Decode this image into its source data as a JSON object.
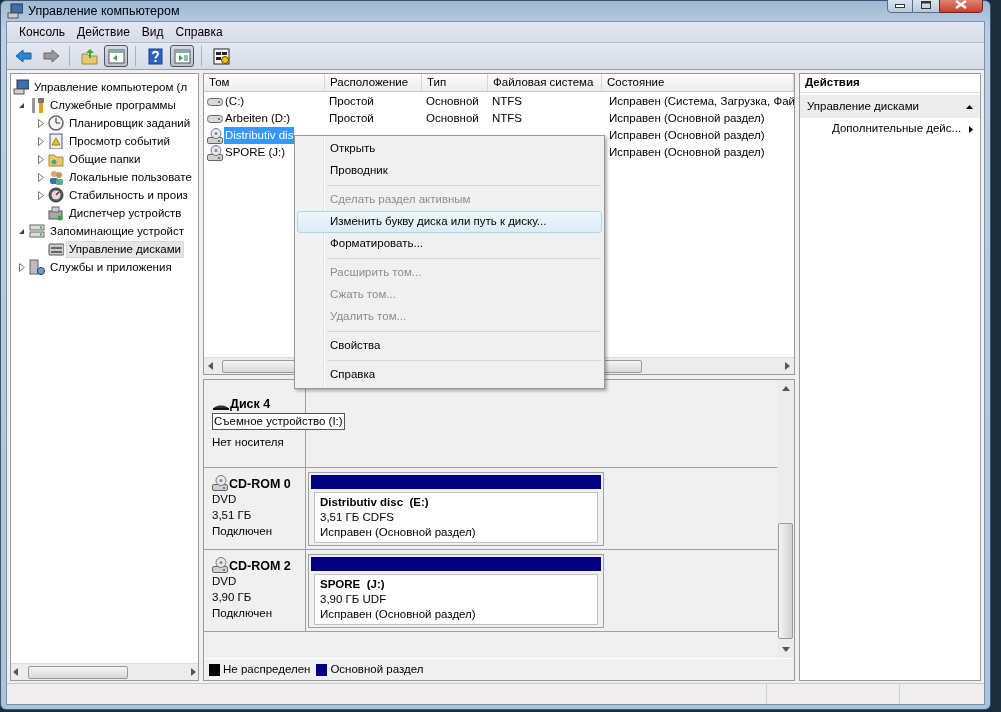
{
  "window": {
    "title": "Управление компьютером"
  },
  "menu": [
    "Консоль",
    "Действие",
    "Вид",
    "Справка"
  ],
  "toolbar": [
    {
      "pressed": false
    },
    {
      "pressed": false
    },
    {
      "pressed": false
    },
    {
      "pressed": true
    },
    {
      "pressed": false
    },
    {
      "pressed": true
    },
    {
      "pressed": false
    }
  ],
  "tree": [
    {
      "label": "Управление компьютером (л",
      "selected": false,
      "children": [
        {
          "label": "Служебные программы",
          "expanded": true,
          "selected": false,
          "children": [
            {
              "label": "Планировщик заданий",
              "expanded": false,
              "selected": false
            },
            {
              "label": "Просмотр событий",
              "expanded": false,
              "selected": false
            },
            {
              "label": "Общие папки",
              "expanded": false,
              "selected": false
            },
            {
              "label": "Локальные пользовате",
              "expanded": false,
              "selected": false
            },
            {
              "label": "Стабильность и произ",
              "expanded": false,
              "selected": false
            },
            {
              "label": "Диспетчер устройств",
              "selected": false
            }
          ]
        },
        {
          "label": "Запоминающие устройст",
          "expanded": true,
          "selected": false,
          "children": [
            {
              "label": "Управление дисками",
              "selected": true
            }
          ]
        },
        {
          "label": "Службы и приложения",
          "expanded": false,
          "selected": false
        }
      ]
    }
  ],
  "table": {
    "columns": [
      "Том",
      "Расположение",
      "Тип",
      "Файловая система",
      "Состояние"
    ],
    "rows": [
      {
        "kind": "disk",
        "selected": false,
        "volume": "(C:)",
        "layout": "Простой",
        "type": "Основной",
        "fs": "NTFS",
        "status": "Исправен (Система, Загрузка, Фай"
      },
      {
        "kind": "disk",
        "selected": false,
        "volume": "Arbeiten (D:)",
        "layout": "Простой",
        "type": "Основной",
        "fs": "NTFS",
        "status": "Исправен (Основной раздел)"
      },
      {
        "kind": "cdrom",
        "selected": true,
        "volume": "Distributiv dis",
        "status": "Исправен (Основной раздел)"
      },
      {
        "kind": "cdrom",
        "selected": false,
        "volume": "SPORE (J:)",
        "status": "Исправен (Основной раздел)"
      }
    ]
  },
  "context_menu": [
    {
      "kind": "item",
      "label": "Открыть",
      "disabled": false,
      "highlighted": false
    },
    {
      "kind": "item",
      "label": "Проводник",
      "disabled": false,
      "highlighted": false
    },
    {
      "kind": "separator"
    },
    {
      "kind": "item",
      "label": "Сделать раздел активным",
      "disabled": true,
      "highlighted": false
    },
    {
      "kind": "item",
      "label": "Изменить букву диска или путь к диску...",
      "disabled": false,
      "highlighted": true
    },
    {
      "kind": "item",
      "label": "Форматировать...",
      "disabled": false,
      "highlighted": false
    },
    {
      "kind": "separator"
    },
    {
      "kind": "item",
      "label": "Расширить том...",
      "disabled": true,
      "highlighted": false
    },
    {
      "kind": "item",
      "label": "Сжать том...",
      "disabled": true,
      "highlighted": false
    },
    {
      "kind": "item",
      "label": "Удалить том...",
      "disabled": true,
      "highlighted": false
    },
    {
      "kind": "separator"
    },
    {
      "kind": "item",
      "label": "Свойства",
      "disabled": false,
      "highlighted": false
    },
    {
      "kind": "separator"
    },
    {
      "kind": "item",
      "label": "Справка",
      "disabled": false,
      "highlighted": false
    }
  ],
  "disks": [
    {
      "kind": "removable",
      "name": "Диск 4",
      "tooltip": "Съемное устройство (I:)",
      "lines": [
        "Нет носителя"
      ]
    },
    {
      "kind": "cdrom",
      "name": "CD-ROM 0",
      "lines": [
        "DVD",
        "3,51 ГБ",
        "Подключен"
      ],
      "partition": {
        "name": "Distributiv disc  (E:)",
        "size": "3,51 ГБ CDFS",
        "status": "Исправен (Основной раздел)",
        "color": "#000080"
      }
    },
    {
      "kind": "cdrom",
      "name": "CD-ROM 2",
      "lines": [
        "DVD",
        "3,90 ГБ",
        "Подключен"
      ],
      "partition": {
        "name": "SPORE  (J:)",
        "size": "3,90 ГБ UDF",
        "status": "Исправен (Основной раздел)",
        "color": "#000080"
      }
    }
  ],
  "legend": [
    {
      "label": "Не распределен",
      "color": "#000000"
    },
    {
      "label": "Основной раздел",
      "color": "#000080"
    }
  ],
  "actions": {
    "title": "Действия",
    "sections": [
      {
        "label": "Управление дисками",
        "expanded": true,
        "items": [
          {
            "label": "Дополнительные дейс...",
            "submenu": true
          }
        ]
      }
    ]
  }
}
